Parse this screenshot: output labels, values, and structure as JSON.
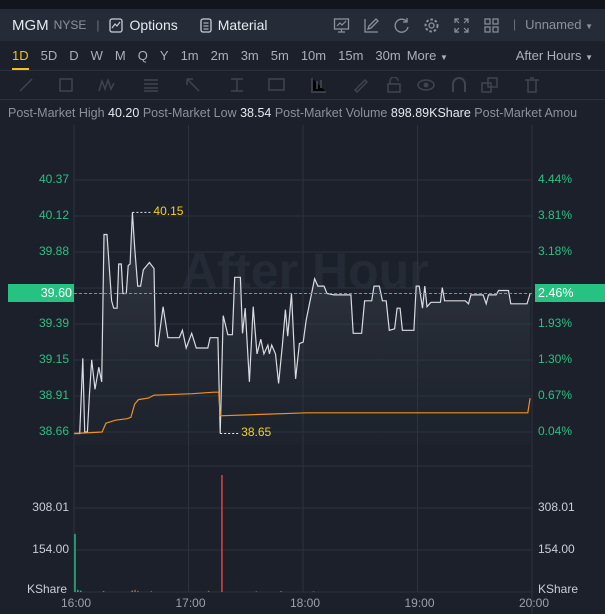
{
  "header": {
    "symbol": "MGM",
    "exchange": "NYSE",
    "options_label": "Options",
    "material_label": "Material",
    "layout_name": "Unnamed"
  },
  "timeframes": [
    "1D",
    "5D",
    "D",
    "W",
    "M",
    "Q",
    "Y",
    "1m",
    "2m",
    "3m",
    "5m",
    "10m",
    "15m",
    "30m",
    "More"
  ],
  "active_timeframe": "1D",
  "session_label": "After Hours",
  "info_bar": {
    "high_label": "Post-Market High",
    "high": "40.20",
    "low_label": "Post-Market Low",
    "low": "38.54",
    "volume_label": "Post-Market Volume",
    "volume": "898.89KShare",
    "amount_label": "Post-Market Amou"
  },
  "watermark": "After Hour",
  "colors": {
    "up": "#26c281",
    "down": "#f0443c",
    "avg": "#f0901e",
    "price": "#d8dbe0",
    "marker": "#f2d21b"
  },
  "chart_data": {
    "type": "line",
    "x_unit": "minutes since 16:00",
    "x_ticks": [
      {
        "label": "16:00",
        "v": 0
      },
      {
        "label": "17:00",
        "v": 60
      },
      {
        "label": "18:00",
        "v": 120
      },
      {
        "label": "19:00",
        "v": 180
      },
      {
        "label": "20:00",
        "v": 240
      }
    ],
    "price_ticks": [
      "40.37",
      "40.12",
      "39.88",
      "39.39",
      "39.15",
      "38.91",
      "38.66"
    ],
    "pct_ticks": [
      "4.44%",
      "3.81%",
      "3.18%",
      "1.93%",
      "1.30%",
      "0.67%",
      "0.04%"
    ],
    "ylim": [
      38.66,
      40.37
    ],
    "current_price": "39.60",
    "current_pct": "2.46%",
    "high_marker": "40.15",
    "low_marker": "38.65",
    "price": [
      [
        0,
        38.65
      ],
      [
        3,
        38.65
      ],
      [
        4.6,
        39.16
      ],
      [
        5.6,
        38.66
      ],
      [
        7,
        38.66
      ],
      [
        8,
        38.9
      ],
      [
        9.3,
        39.15
      ],
      [
        11,
        38.95
      ],
      [
        13,
        39.1
      ],
      [
        14.5,
        39.0
      ],
      [
        15.7,
        40.0
      ],
      [
        17.3,
        40.0
      ],
      [
        19.7,
        39.55
      ],
      [
        20.8,
        39.5
      ],
      [
        22.6,
        39.5
      ],
      [
        23.4,
        39.8
      ],
      [
        24.8,
        39.8
      ],
      [
        25.6,
        39.6
      ],
      [
        27.4,
        39.6
      ],
      [
        28.4,
        39.79
      ],
      [
        29.4,
        39.8
      ],
      [
        30.6,
        40.15
      ],
      [
        31.8,
        39.91
      ],
      [
        33.4,
        39.65
      ],
      [
        34.9,
        39.65
      ],
      [
        36.3,
        39.76
      ],
      [
        39.5,
        39.81
      ],
      [
        41.9,
        39.77
      ],
      [
        42.7,
        39.25
      ],
      [
        43.9,
        39.24
      ],
      [
        46.7,
        39.51
      ],
      [
        49.2,
        39.3
      ],
      [
        55.2,
        39.3
      ],
      [
        56.8,
        39.35
      ],
      [
        58.8,
        39.23
      ],
      [
        61.7,
        39.33
      ],
      [
        64.1,
        39.23
      ],
      [
        70.1,
        39.23
      ],
      [
        71.3,
        39.3
      ],
      [
        75.4,
        39.3
      ],
      [
        76.6,
        38.65
      ],
      [
        78.2,
        39.45
      ],
      [
        80.6,
        39.32
      ],
      [
        83,
        39.32
      ],
      [
        84.2,
        39.71
      ],
      [
        87.2,
        39.71
      ],
      [
        88.3,
        39.33
      ],
      [
        89.7,
        39.5
      ],
      [
        91.9,
        39.0
      ],
      [
        93.9,
        39.51
      ],
      [
        95.9,
        39.19
      ],
      [
        97.9,
        39.29
      ],
      [
        99.5,
        39.19
      ],
      [
        101.6,
        39.25
      ],
      [
        102.4,
        39.19
      ],
      [
        103.6,
        39.25
      ],
      [
        105.6,
        39.19
      ],
      [
        107.2,
        38.99
      ],
      [
        109.2,
        39.25
      ],
      [
        110.8,
        39.49
      ],
      [
        112,
        39.31
      ],
      [
        114,
        39.6
      ],
      [
        116.1,
        39.02
      ],
      [
        118.1,
        39.26
      ],
      [
        120.1,
        39.27
      ],
      [
        121.7,
        39.42
      ],
      [
        123.7,
        39.55
      ],
      [
        126.1,
        39.7
      ],
      [
        127.8,
        39.65
      ],
      [
        131,
        39.65
      ],
      [
        132.6,
        39.6
      ],
      [
        136.2,
        39.59
      ],
      [
        145.1,
        39.59
      ],
      [
        146.3,
        39.33
      ],
      [
        150.7,
        39.33
      ],
      [
        152.3,
        39.55
      ],
      [
        156,
        39.55
      ],
      [
        157.2,
        39.65
      ],
      [
        160,
        39.65
      ],
      [
        161.6,
        39.55
      ],
      [
        163.6,
        39.55
      ],
      [
        165.2,
        39.35
      ],
      [
        168,
        39.36
      ],
      [
        169.3,
        39.5
      ],
      [
        170.9,
        39.5
      ],
      [
        172.1,
        39.35
      ],
      [
        178.1,
        39.35
      ],
      [
        179.3,
        39.65
      ],
      [
        180.9,
        39.65
      ],
      [
        182.6,
        39.5
      ],
      [
        183.8,
        39.65
      ],
      [
        185,
        39.51
      ],
      [
        187,
        39.54
      ],
      [
        192,
        39.54
      ],
      [
        193,
        39.64
      ],
      [
        194.2,
        39.55
      ],
      [
        205.1,
        39.55
      ],
      [
        206.7,
        39.53
      ],
      [
        208,
        39.59
      ],
      [
        214.4,
        39.59
      ],
      [
        216,
        39.53
      ],
      [
        217.2,
        39.59
      ],
      [
        221.2,
        39.59
      ],
      [
        222.5,
        39.62
      ],
      [
        227.7,
        39.62
      ],
      [
        228.9,
        39.53
      ],
      [
        237.4,
        39.53
      ],
      [
        239,
        39.6
      ]
    ],
    "avg_price": [
      [
        0,
        38.65
      ],
      [
        14.7,
        38.66
      ],
      [
        16.7,
        38.72
      ],
      [
        21.8,
        38.74
      ],
      [
        27.8,
        38.75
      ],
      [
        29.8,
        38.76
      ],
      [
        31.8,
        38.85
      ],
      [
        33.8,
        38.88
      ],
      [
        38.9,
        38.89
      ],
      [
        41.9,
        38.91
      ],
      [
        62,
        38.92
      ],
      [
        73.2,
        38.93
      ],
      [
        75.8,
        38.93
      ],
      [
        76.6,
        38.77
      ],
      [
        122.1,
        38.79
      ],
      [
        237.8,
        38.79
      ],
      [
        239,
        38.89
      ]
    ],
    "volume_unit": "KShare",
    "volume_ticks": [
      "308.01",
      "154.00"
    ],
    "volume_tick_values": [
      308.01,
      154.0
    ],
    "volume": [
      [
        0,
        213,
        "up"
      ],
      [
        1.5,
        8,
        "up"
      ],
      [
        3,
        5,
        "up"
      ],
      [
        15,
        3,
        "up"
      ],
      [
        30,
        5,
        "up"
      ],
      [
        31.5,
        8,
        "down"
      ],
      [
        33,
        4,
        "down"
      ],
      [
        40,
        3,
        "down"
      ],
      [
        70,
        4,
        "down"
      ],
      [
        77,
        429,
        "down"
      ],
      [
        95,
        2,
        "up"
      ],
      [
        108,
        3,
        "up"
      ],
      [
        125,
        2,
        "up"
      ]
    ]
  }
}
